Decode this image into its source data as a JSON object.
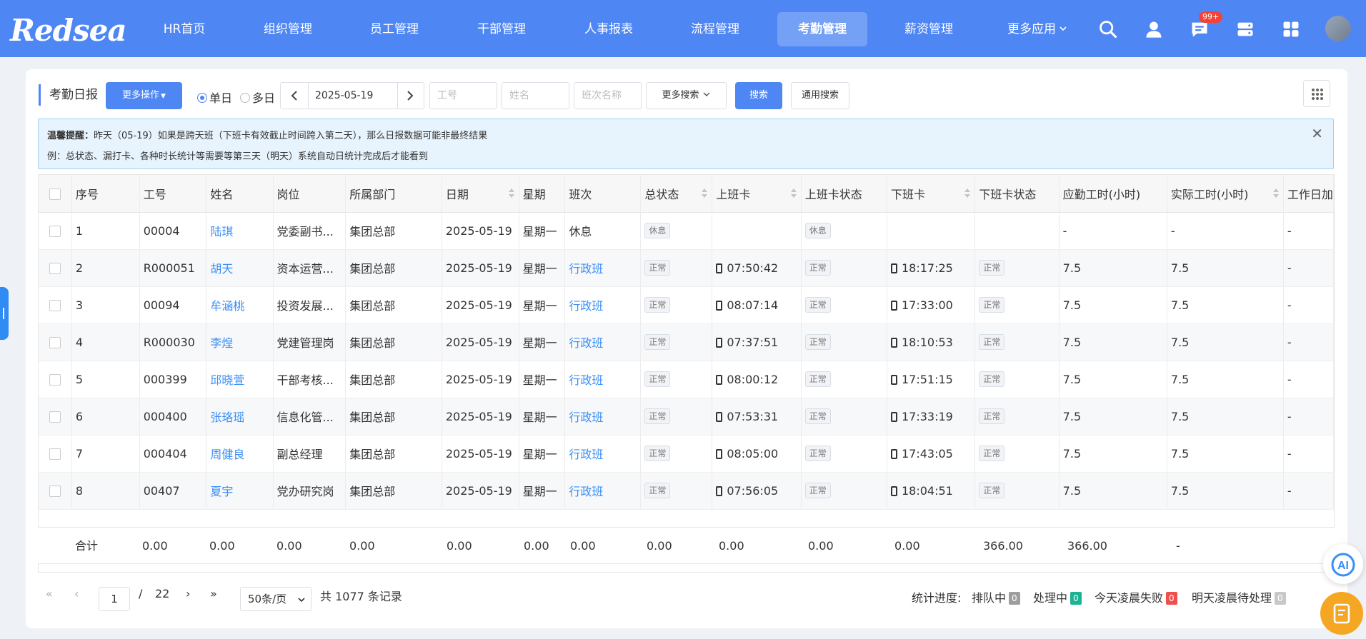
{
  "brand": {
    "logo_text": "Redsea"
  },
  "nav": {
    "items": [
      "HR首页",
      "组织管理",
      "员工管理",
      "干部管理",
      "人事报表",
      "流程管理",
      "考勤管理",
      "薪资管理",
      "更多应用"
    ],
    "active_index": 6,
    "notification_badge": "99+"
  },
  "toolbar": {
    "title": "考勤日报",
    "more_ops": "更多操作",
    "radio_single": "单日",
    "radio_multi": "多日",
    "radio_selected": "单日",
    "date_value": "2025-05-19",
    "emp_id_placeholder": "工号",
    "name_placeholder": "姓名",
    "shift_placeholder": "班次名称",
    "more_search": "更多搜索",
    "search": "搜索",
    "general_search": "通用搜索"
  },
  "notice": {
    "label": "温馨提醒：",
    "line1": "昨天（05-19）如果是跨天班（下班卡有效截止时间跨入第二天），那么日报数据可能非最终结果",
    "line2": "例：总状态、漏打卡、各种时长统计等需要等第三天（明天）系统自动日统计完成后才能看到"
  },
  "table": {
    "headers": [
      "序号",
      "工号",
      "姓名",
      "岗位",
      "所属部门",
      "日期",
      "星期",
      "班次",
      "总状态",
      "上班卡",
      "上班卡状态",
      "下班卡",
      "下班卡状态",
      "应勤工时(小时)",
      "实际工时(小时)",
      "工作日加"
    ],
    "rows": [
      {
        "no": "1",
        "id": "00004",
        "name": "陆琪",
        "post": "党委副书...",
        "dept": "集团总部",
        "date": "2025-05-19",
        "week": "星期一",
        "shift": "休息",
        "status": "休息",
        "in": "",
        "in_status": "休息",
        "out": "",
        "out_status": "",
        "plan": "-",
        "actual": "-",
        "extra": "-"
      },
      {
        "no": "2",
        "id": "R000051",
        "name": "胡天",
        "post": "资本运营...",
        "dept": "集团总部",
        "date": "2025-05-19",
        "week": "星期一",
        "shift": "行政班",
        "status": "正常",
        "in": "07:50:42",
        "in_status": "正常",
        "out": "18:17:25",
        "out_status": "正常",
        "plan": "7.5",
        "actual": "7.5",
        "extra": "-"
      },
      {
        "no": "3",
        "id": "00094",
        "name": "牟涵桃",
        "post": "投资发展...",
        "dept": "集团总部",
        "date": "2025-05-19",
        "week": "星期一",
        "shift": "行政班",
        "status": "正常",
        "in": "08:07:14",
        "in_status": "正常",
        "out": "17:33:00",
        "out_status": "正常",
        "plan": "7.5",
        "actual": "7.5",
        "extra": "-"
      },
      {
        "no": "4",
        "id": "R000030",
        "name": "李煌",
        "post": "党建管理岗",
        "dept": "集团总部",
        "date": "2025-05-19",
        "week": "星期一",
        "shift": "行政班",
        "status": "正常",
        "in": "07:37:51",
        "in_status": "正常",
        "out": "18:10:53",
        "out_status": "正常",
        "plan": "7.5",
        "actual": "7.5",
        "extra": "-"
      },
      {
        "no": "5",
        "id": "000399",
        "name": "邱晓萱",
        "post": "干部考核...",
        "dept": "集团总部",
        "date": "2025-05-19",
        "week": "星期一",
        "shift": "行政班",
        "status": "正常",
        "in": "08:00:12",
        "in_status": "正常",
        "out": "17:51:15",
        "out_status": "正常",
        "plan": "7.5",
        "actual": "7.5",
        "extra": "-"
      },
      {
        "no": "6",
        "id": "000400",
        "name": "张珞瑶",
        "post": "信息化管...",
        "dept": "集团总部",
        "date": "2025-05-19",
        "week": "星期一",
        "shift": "行政班",
        "status": "正常",
        "in": "07:53:31",
        "in_status": "正常",
        "out": "17:33:19",
        "out_status": "正常",
        "plan": "7.5",
        "actual": "7.5",
        "extra": "-"
      },
      {
        "no": "7",
        "id": "000404",
        "name": "周健良",
        "post": "副总经理",
        "dept": "集团总部",
        "date": "2025-05-19",
        "week": "星期一",
        "shift": "行政班",
        "status": "正常",
        "in": "08:05:00",
        "in_status": "正常",
        "out": "17:43:05",
        "out_status": "正常",
        "plan": "7.5",
        "actual": "7.5",
        "extra": "-"
      },
      {
        "no": "8",
        "id": "00407",
        "name": "夏宇",
        "post": "党办研究岗",
        "dept": "集团总部",
        "date": "2025-05-19",
        "week": "星期一",
        "shift": "行政班",
        "status": "正常",
        "in": "07:56:05",
        "in_status": "正常",
        "out": "18:04:51",
        "out_status": "正常",
        "plan": "7.5",
        "actual": "7.5",
        "extra": "-"
      }
    ],
    "totals": {
      "label": "合计",
      "values": [
        "0.00",
        "0.00",
        "0.00",
        "0.00",
        "0.00",
        "0.00",
        "0.00",
        "0.00",
        "0.00",
        "0.00",
        "0.00",
        "366.00",
        "366.00",
        "-"
      ]
    }
  },
  "pager": {
    "page": "1",
    "sep": "/",
    "total_pages": "22",
    "page_size": "50条/页",
    "total_prefix": "共",
    "total": "1077",
    "total_suffix": "条记录"
  },
  "stats": {
    "label": "统计进度:",
    "items": [
      {
        "name": "排队中",
        "count": "0",
        "color": "#9e9e9e"
      },
      {
        "name": "处理中",
        "count": "0",
        "color": "#1ab394"
      },
      {
        "name": "今天凌晨失败",
        "count": "0",
        "color": "#f0504d"
      },
      {
        "name": "明天凌晨待处理",
        "count": "0",
        "color": "#c8c8c8"
      }
    ]
  },
  "ai_label": "AI"
}
